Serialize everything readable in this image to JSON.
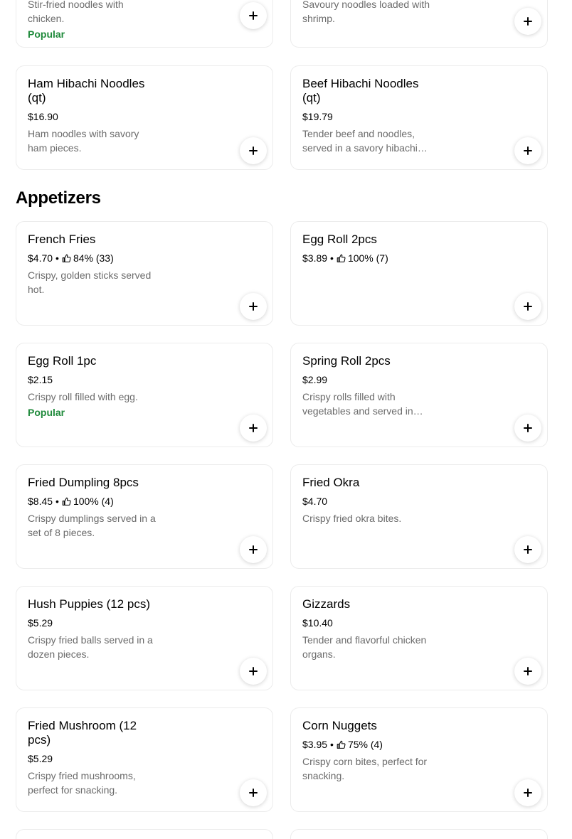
{
  "top_cards": [
    {
      "description": "Stir-fried noodles with chicken.",
      "popular": "Popular"
    },
    {
      "description": "Savoury noodles loaded with shrimp."
    }
  ],
  "noodle_cards": [
    {
      "name": "Ham Hibachi Noodles (qt)",
      "price": "$16.90",
      "description": "Ham noodles with savory ham pieces."
    },
    {
      "name": "Beef Hibachi Noodles (qt)",
      "price": "$19.79",
      "description": "Tender beef and noodles, served in a savory hibachi sauce."
    }
  ],
  "appetizers": {
    "title": "Appetizers",
    "items": [
      {
        "name": "French Fries",
        "price": "$4.70",
        "rating": "84% (33)",
        "description": "Crispy, golden sticks served hot."
      },
      {
        "name": "Egg Roll 2pcs",
        "price": "$3.89",
        "rating": "100% (7)"
      },
      {
        "name": "Egg Roll 1pc",
        "price": "$2.15",
        "description": "Crispy roll filled with egg.",
        "popular": "Popular"
      },
      {
        "name": "Spring Roll 2pcs",
        "price": "$2.99",
        "description": "Crispy rolls filled with vegetables and served in pairs."
      },
      {
        "name": "Fried Dumpling 8pcs",
        "price": "$8.45",
        "rating": "100% (4)",
        "description": "Crispy dumplings served in a set of 8 pieces."
      },
      {
        "name": "Fried Okra",
        "price": "$4.70",
        "description": "Crispy fried okra bites."
      },
      {
        "name": "Hush Puppies (12 pcs)",
        "price": "$5.29",
        "description": "Crispy fried balls served in a dozen pieces."
      },
      {
        "name": "Gizzards",
        "price": "$10.40",
        "description": "Tender and flavorful chicken organs."
      },
      {
        "name": "Fried Mushroom (12 pcs)",
        "price": "$5.29",
        "description": "Crispy fried mushrooms, perfect for snacking."
      },
      {
        "name": "Corn Nuggets",
        "price": "$3.95",
        "rating": "75% (4)",
        "description": "Crispy corn bites, perfect for snacking."
      }
    ]
  },
  "icons": {
    "add": "plus-icon",
    "rating": "thumbs-up-icon"
  },
  "colors": {
    "popular": "#1f8a3b",
    "description": "#6b6b6b",
    "border": "#ececec"
  }
}
